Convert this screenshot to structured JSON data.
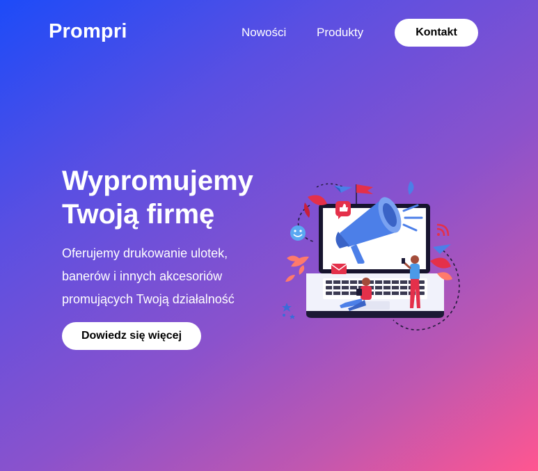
{
  "nav": {
    "logo": "Prompri",
    "links": [
      {
        "label": "Nowości"
      },
      {
        "label": "Produkty"
      }
    ],
    "contact_label": "Kontakt"
  },
  "hero": {
    "title_lines": [
      "Wypromujemy",
      "Twoją firmę"
    ],
    "description_lines": [
      "Oferujemy drukowanie ulotek,",
      "banerów i innych akcesoriów",
      "promujących Twoją działalność"
    ],
    "cta_label": "Dowiedz się więcej",
    "illustration_icon": "marketing-laptop-megaphone-icon"
  },
  "colors": {
    "gradient_start": "#1d4bf8",
    "gradient_mid": "#8b52cc",
    "gradient_end": "#ff5690",
    "button_bg": "#ffffff",
    "button_text": "#000000"
  }
}
